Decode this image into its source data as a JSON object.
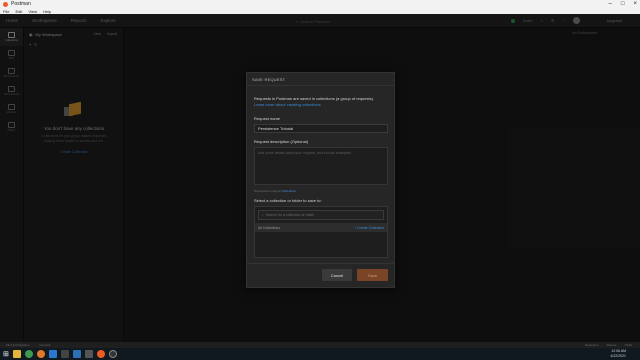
{
  "window": {
    "title": "Postman"
  },
  "menu": [
    "File",
    "Edit",
    "View",
    "Help"
  ],
  "header": {
    "nav": [
      "Home",
      "Workspaces",
      "Reports",
      "Explore"
    ],
    "search_placeholder": "Search Postman",
    "invite_label": "Invite",
    "upgrade_label": "Upgrade"
  },
  "rail": [
    "Collections",
    "APIs",
    "Environments",
    "Mock Servers",
    "Monitors",
    "History"
  ],
  "sidebar": {
    "workspace": "My Workspace",
    "new_label": "New",
    "import_label": "Import",
    "empty_title": "You don't have any collections",
    "empty_desc": "Collections let you group related requests, making them easier to access and run.",
    "empty_link": "Create Collection"
  },
  "main": {
    "env_label": "No Environment"
  },
  "modal": {
    "header": "SAVE REQUEST",
    "info": "Requests in Postman are saved in collections (a group of requests).",
    "info_link": "Learn more about creating collections",
    "name_label": "Request name",
    "name_value": "Persistence Tutorial",
    "desc_label": "Request description (Optional)",
    "desc_placeholder": "Add some details about your request, and include examples",
    "md_note": "Descriptions support",
    "md_link": "Markdown",
    "select_label": "Select a collection or folder to save to:",
    "tree_search_placeholder": "Search for a collection or folder",
    "all_collections": "All Collections",
    "create_collection": "+ Create Collection",
    "cancel_label": "Cancel",
    "save_label": "Save"
  },
  "statusbar": {
    "left": [
      "Find and Replace",
      "Console"
    ],
    "right": [
      "Bootcamp",
      "Runner",
      "Trash"
    ]
  },
  "taskbar": {
    "time": "12:06 AM",
    "date": "4/22/2021"
  },
  "colors": {
    "accent": "#ef5b25",
    "link": "#3d8fd6",
    "save_button": "#7a4527"
  }
}
